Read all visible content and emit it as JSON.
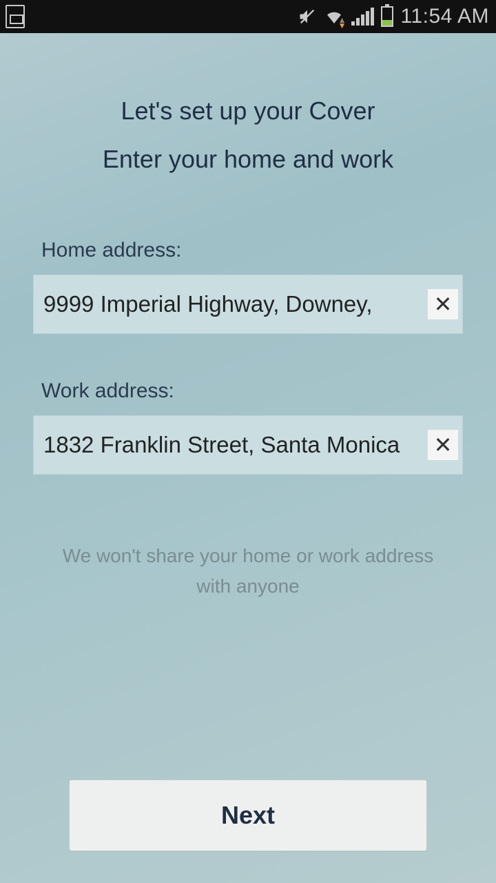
{
  "status": {
    "time": "11:54 AM"
  },
  "heading": {
    "title": "Let's set up your Cover",
    "subtitle": "Enter your home and work"
  },
  "fields": {
    "home": {
      "label": "Home address:",
      "value": "9999 Imperial Highway, Downey,"
    },
    "work": {
      "label": "Work address:",
      "value": "1832 Franklin Street, Santa Monica"
    }
  },
  "privacy_note": "We won't share your home or work address with anyone",
  "buttons": {
    "next": "Next"
  }
}
